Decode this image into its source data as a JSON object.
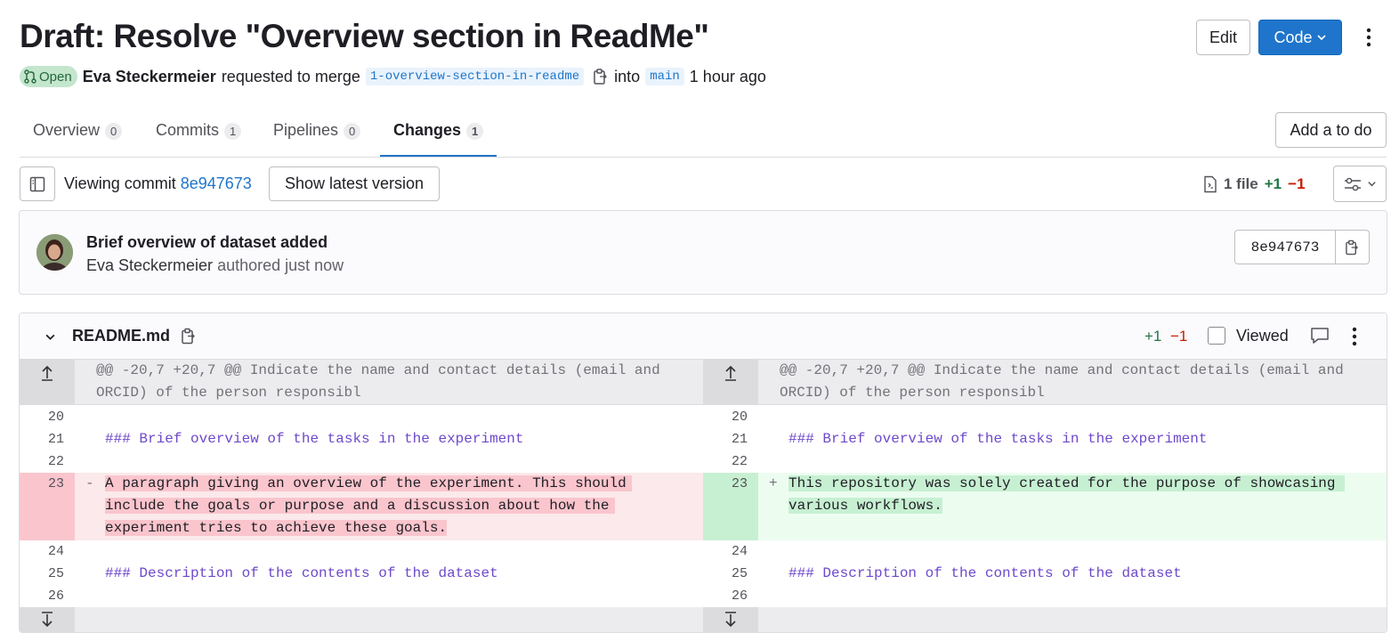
{
  "title": "Draft: Resolve \"Overview section in ReadMe\"",
  "header_buttons": {
    "edit": "Edit",
    "code": "Code"
  },
  "meta": {
    "status": "Open",
    "author": "Eva Steckermeier",
    "action": "requested to merge",
    "source_branch": "1-overview-section-in-readme",
    "into": "into",
    "target_branch": "main",
    "time": "1 hour ago"
  },
  "tabs": [
    {
      "label": "Overview",
      "count": "0"
    },
    {
      "label": "Commits",
      "count": "1"
    },
    {
      "label": "Pipelines",
      "count": "0"
    },
    {
      "label": "Changes",
      "count": "1"
    }
  ],
  "add_todo": "Add a to do",
  "viewing": {
    "prefix": "Viewing commit",
    "sha": "8e947673",
    "show_latest": "Show latest version"
  },
  "file_stats": {
    "files": "1 file",
    "added": "+1",
    "removed": "−1"
  },
  "commit": {
    "title": "Brief overview of dataset added",
    "author": "Eva Steckermeier",
    "authored": "authored just now",
    "sha": "8e947673"
  },
  "file": {
    "name": "README.md",
    "added": "+1",
    "removed": "−1",
    "viewed": "Viewed",
    "hunk_header": "@@ -20,7 +20,7 @@ Indicate the name and contact details (email and ORCID) of the person responsibl",
    "lines": {
      "n20": "20",
      "n21": "21",
      "n22": "22",
      "n23": "23",
      "n24": "24",
      "n25": "25",
      "n26": "26",
      "l21": "### Brief overview of the tasks in the experiment",
      "l25": "### Description of the contents of the dataset",
      "old23_a": "A paragraph giving an overview of the experiment. This should",
      "old23_b": "include the goals or purpose and a discussion about how the",
      "old23_c": "experiment tries to achieve these goals.",
      "new23_a": "This repository was solely created for the purpose of showcasing",
      "new23_b": "various workflows.",
      "minus": "-",
      "plus": "+"
    }
  },
  "colors": {
    "accent": "#1f75cb",
    "added_bg": "#ecfdf0",
    "removed_bg": "#fbe9eb",
    "added_hl": "#c7f0d2",
    "removed_hl": "#fac5cd",
    "open_badge": "#c3e6cd"
  }
}
